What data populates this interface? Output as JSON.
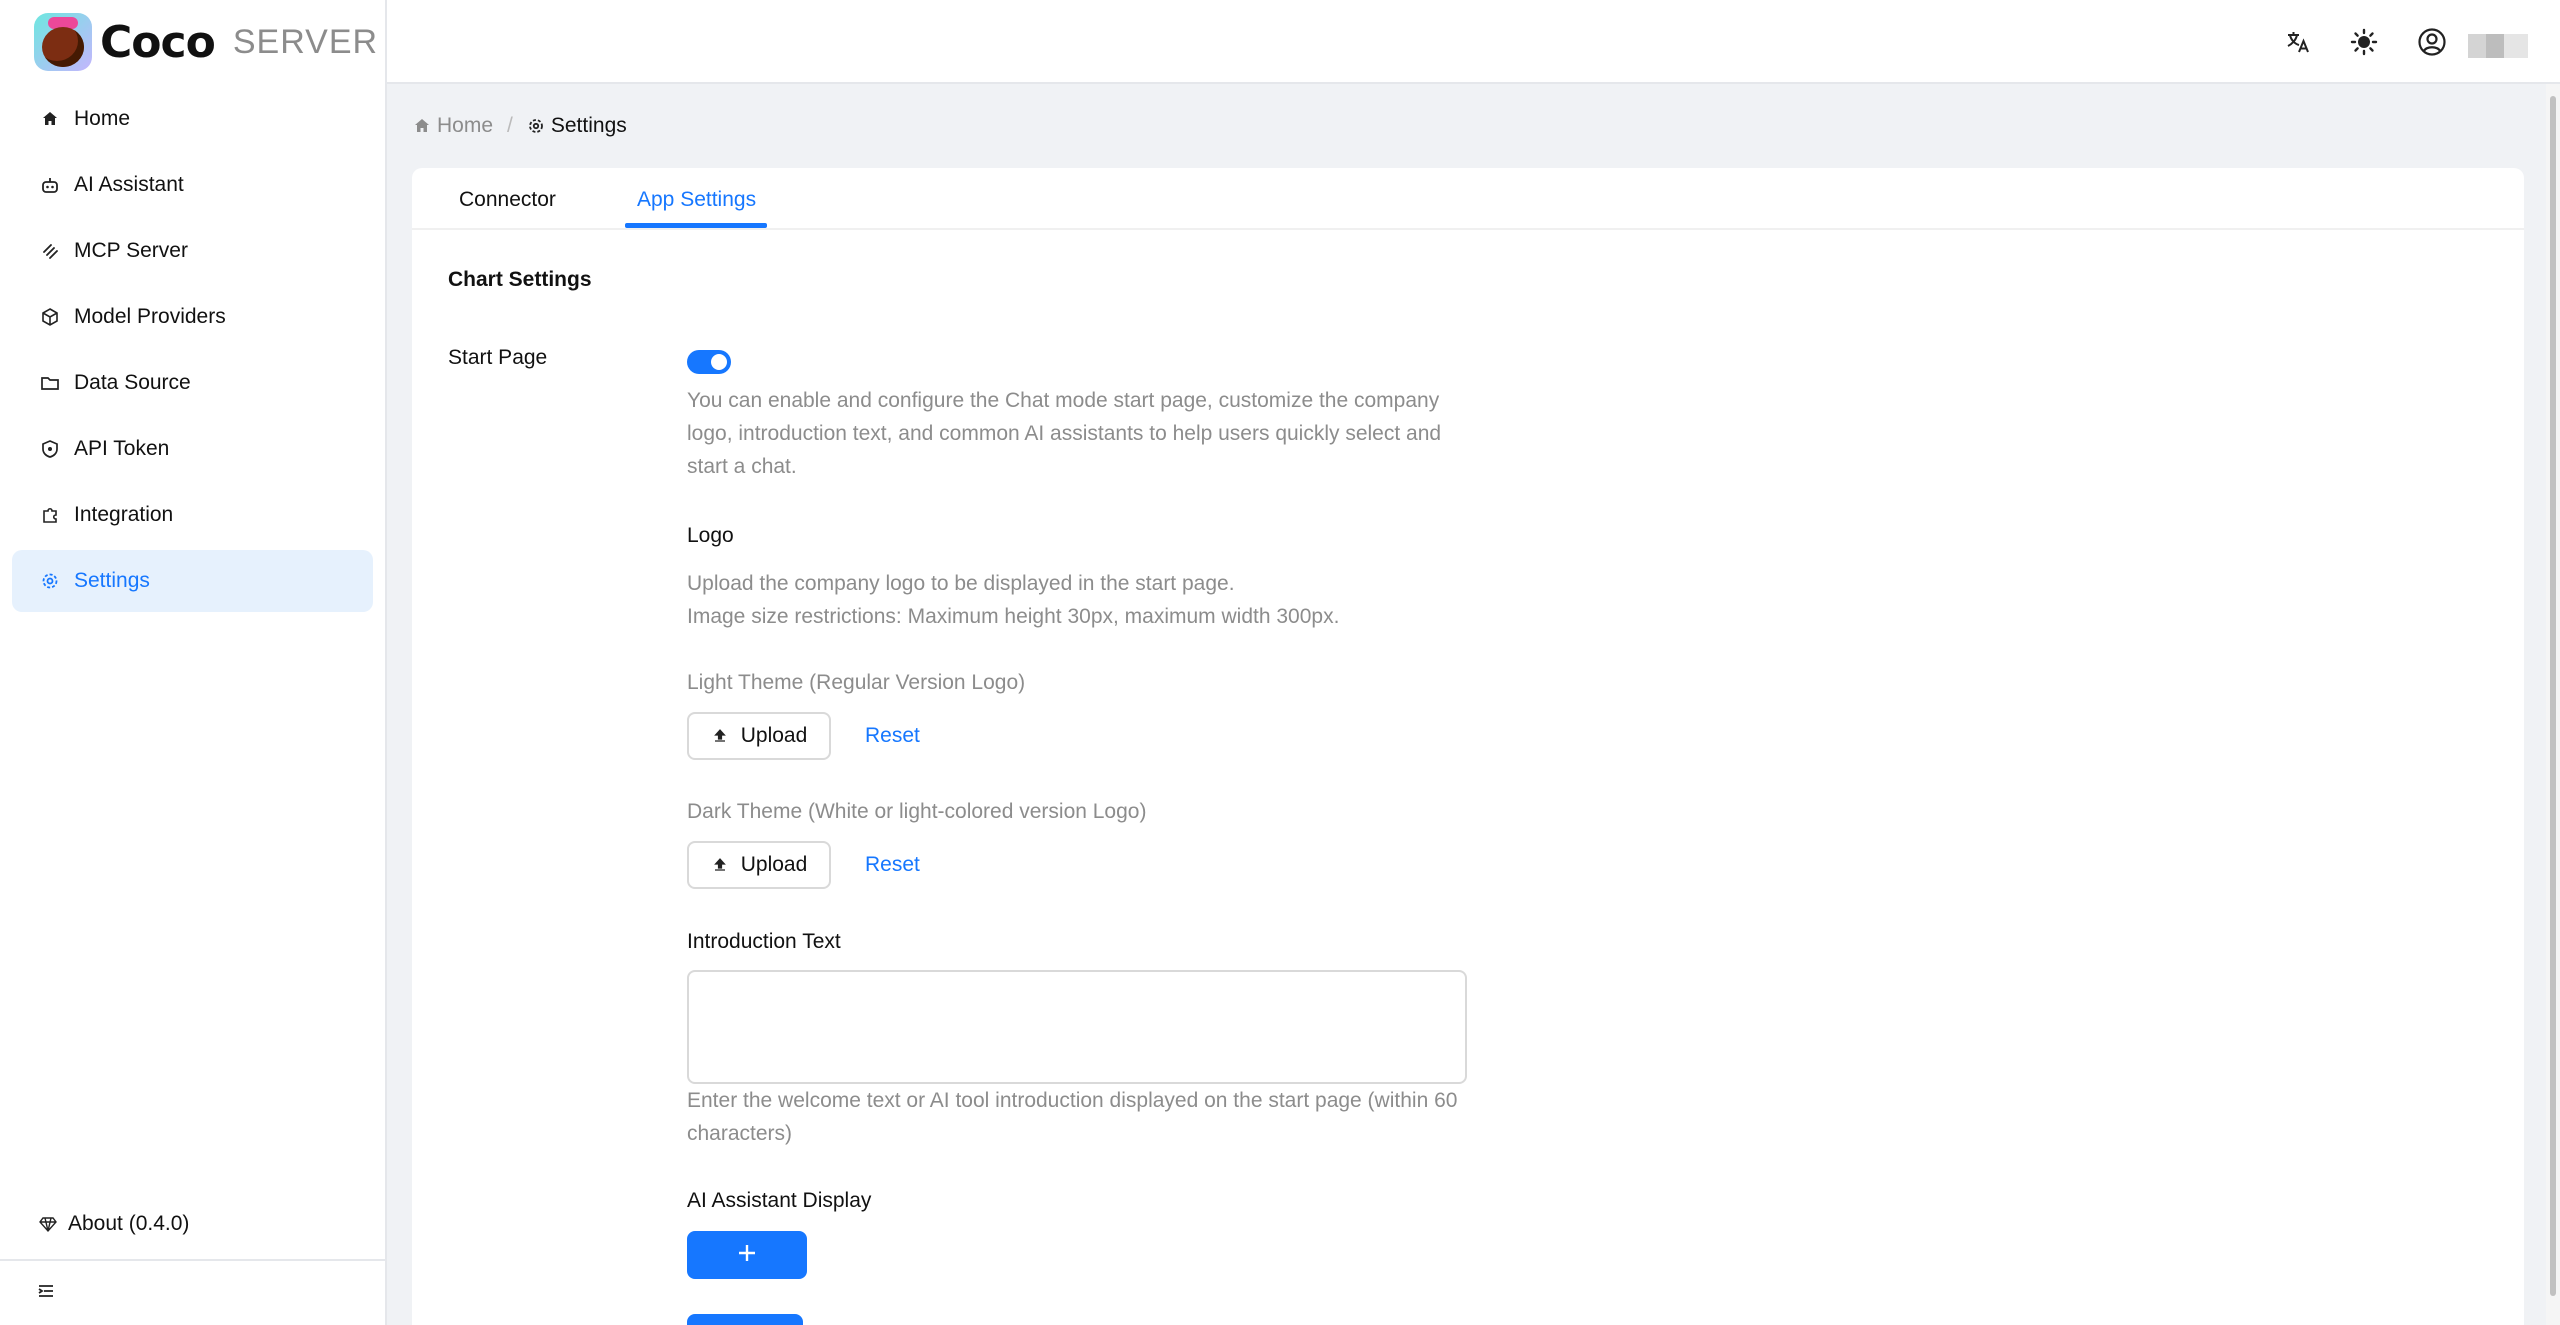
{
  "app": {
    "name": "Coco",
    "subtitle": "SERVER"
  },
  "sidebar": {
    "items": [
      {
        "label": "Home",
        "icon": "home-icon"
      },
      {
        "label": "AI Assistant",
        "icon": "robot-icon"
      },
      {
        "label": "MCP Server",
        "icon": "mcp-icon"
      },
      {
        "label": "Model Providers",
        "icon": "cube-icon"
      },
      {
        "label": "Data Source",
        "icon": "folder-icon"
      },
      {
        "label": "API Token",
        "icon": "shield-icon"
      },
      {
        "label": "Integration",
        "icon": "puzzle-icon"
      },
      {
        "label": "Settings",
        "icon": "gear-icon",
        "active": true
      }
    ],
    "about": "About (0.4.0)"
  },
  "header": {
    "icons": [
      "translate-icon",
      "theme-sun-icon",
      "user-avatar-icon"
    ]
  },
  "breadcrumb": {
    "home": "Home",
    "separator": "/",
    "current": "Settings"
  },
  "tabs": [
    {
      "label": "Connector",
      "active": false
    },
    {
      "label": "App Settings",
      "active": true
    }
  ],
  "settings": {
    "section_title": "Chart Settings",
    "start_page": {
      "label": "Start Page",
      "enabled": true,
      "description": "You can enable and configure the Chat mode start page, customize the company logo, introduction text, and common AI assistants to help users quickly select and start a chat."
    },
    "logo": {
      "title": "Logo",
      "description_line1": "Upload the company logo to be displayed in the start page.",
      "description_line2": "Image size restrictions: Maximum height 30px, maximum width 300px.",
      "light_theme_label": "Light Theme (Regular Version Logo)",
      "dark_theme_label": "Dark Theme (White or light-colored version Logo)",
      "upload_label": "Upload",
      "reset_label": "Reset"
    },
    "introduction": {
      "title": "Introduction Text",
      "value": "",
      "hint": "Enter the welcome text or AI tool introduction displayed on the start page (within 60 characters)"
    },
    "ai_assistant_display": {
      "title": "AI Assistant Display"
    }
  },
  "colors": {
    "accent": "#1677ff",
    "active_bg": "#e6f1fd",
    "muted": "#8c8c8c"
  }
}
